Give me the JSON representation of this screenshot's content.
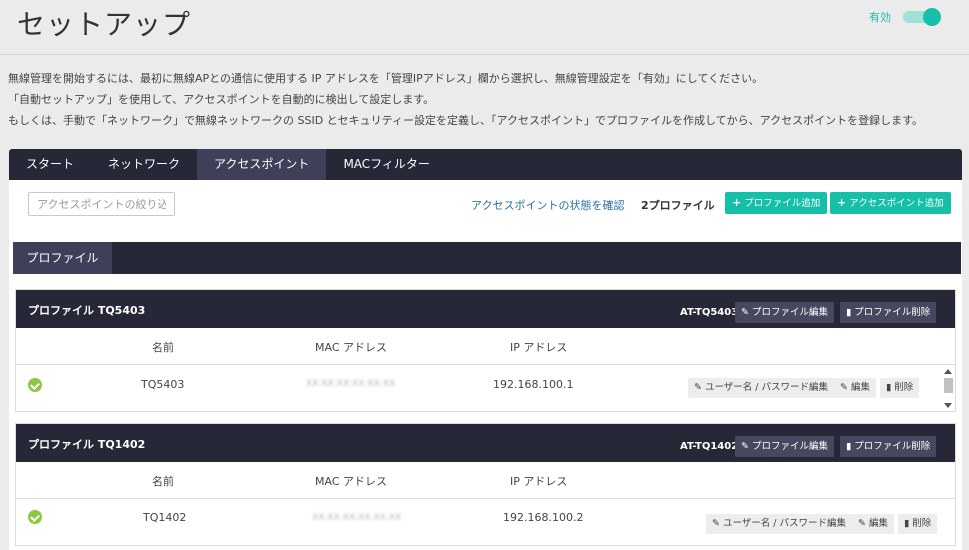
{
  "header": {
    "title": "セットアップ",
    "toggle_label": "有効"
  },
  "description": [
    "無線管理を開始するには、最初に無線APとの通信に使用する IP アドレスを「管理IPアドレス」欄から選択し、無線管理設定を「有効」にしてください。",
    "「自動セットアップ」を使用して、アクセスポイントを自動的に検出して設定します。",
    "もしくは、手動で「ネットワーク」で無線ネットワークの SSID とセキュリティー設定を定義し、「アクセスポイント」でプロファイルを作成してから、アクセスポイントを登録します。"
  ],
  "tabs": [
    "スタート",
    "ネットワーク",
    "アクセスポイント",
    "MACフィルター"
  ],
  "toolbar": {
    "filter_placeholder": "アクセスポイントの絞り込",
    "status_link": "アクセスポイントの状態を確認",
    "profile_count": "2プロファイル",
    "add_profile": "プロファイル追加",
    "add_ap": "アクセスポイント追加"
  },
  "section_tab": "プロファイル",
  "columns": {
    "name": "名前",
    "mac": "MAC アドレス",
    "ip": "IP アドレス"
  },
  "buttons": {
    "edit_profile": "プロファイル編集",
    "delete_profile": "プロファイル削除",
    "user_pass_edit": "ユーザー名 / パスワード編集",
    "edit": "編集",
    "delete": "削除"
  },
  "profiles": [
    {
      "title": "プロファイル TQ5403",
      "code": "AT-TQ5403",
      "ap_name": "TQ5403",
      "mac": "XX:XX:XX:XX:XX:XX",
      "ip": "192.168.100.1"
    },
    {
      "title": "プロファイル TQ1402",
      "code": "AT-TQ1402",
      "ap_name": "TQ1402",
      "mac": "XX:XX:XX:XX:XX:XX",
      "ip": "192.168.100.2"
    }
  ],
  "colors": {
    "accent": "#16c0a8",
    "dark": "#262838",
    "active_tab": "#3d4058",
    "status_ok": "#8dc63f",
    "link": "#2b6f9f"
  }
}
